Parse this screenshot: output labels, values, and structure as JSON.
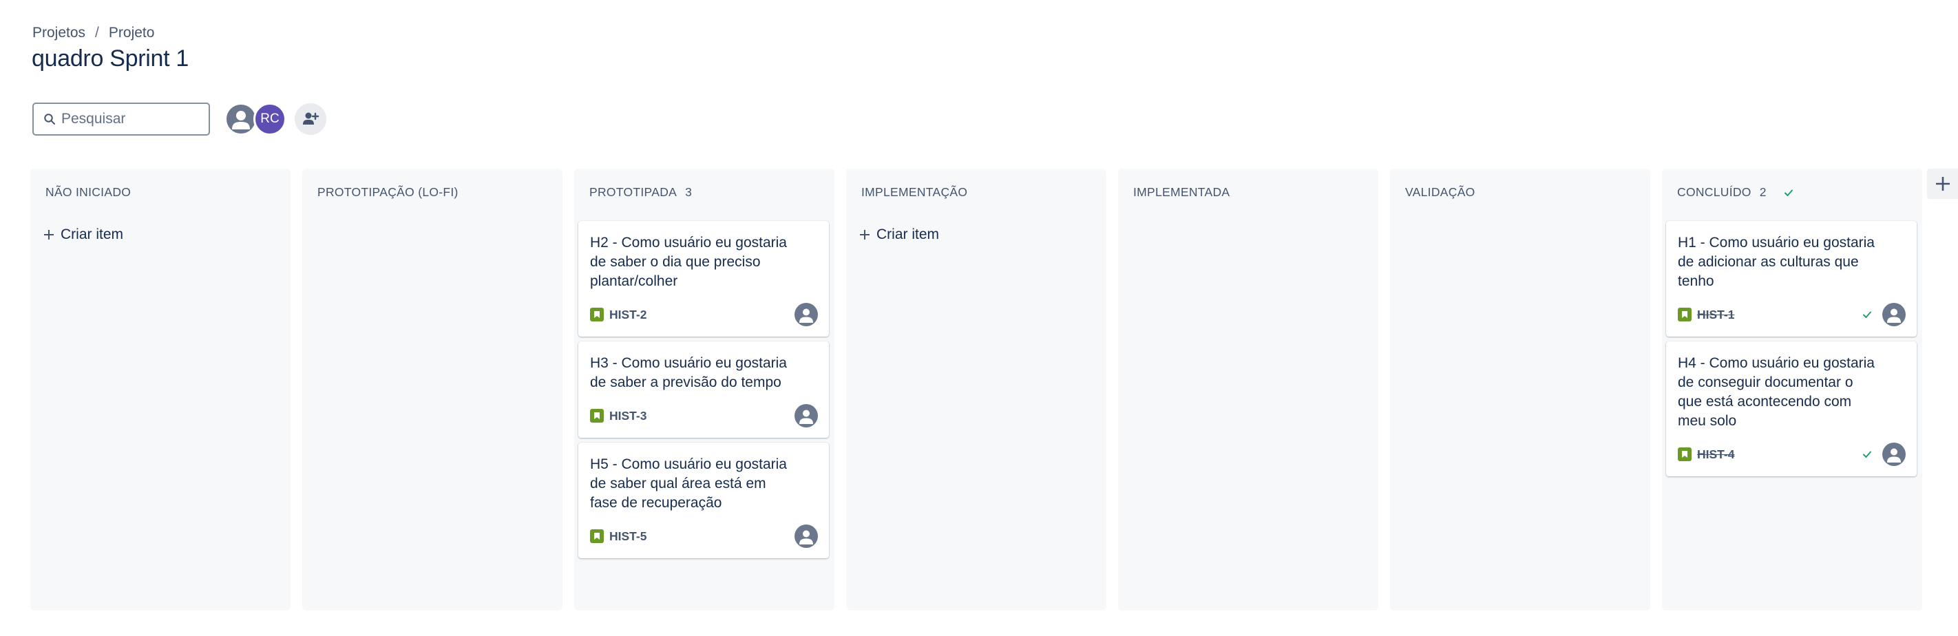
{
  "breadcrumb": {
    "items": [
      "Projetos",
      "Projeto"
    ],
    "separator": "/"
  },
  "page": {
    "title": "quadro Sprint 1"
  },
  "search": {
    "placeholder": "Pesquisar",
    "value": ""
  },
  "avatars": [
    {
      "type": "generic"
    },
    {
      "initials": "RC",
      "color": "#5e4db2"
    },
    {
      "type": "add-people"
    }
  ],
  "columns": [
    {
      "name": "NÃO INICIADO",
      "count": "",
      "create_label": "Criar item",
      "cards": []
    },
    {
      "name": "PROTOTIPAÇÃO (LO-FI)",
      "count": "",
      "cards": []
    },
    {
      "name": "PROTOTIPADA",
      "count": "3",
      "cards": [
        {
          "title": "H2 - Como usuário eu gostaria de saber o dia que preciso plantar/colher",
          "key": "HIST-2",
          "done": false
        },
        {
          "title": "H3 - Como usuário eu gostaria de saber a previsão do tempo",
          "key": "HIST-3",
          "done": false
        },
        {
          "title": "H5 - Como usuário eu gostaria de saber qual área está em fase de recuperação",
          "key": "HIST-5",
          "done": false
        }
      ]
    },
    {
      "name": "IMPLEMENTAÇÃO",
      "count": "",
      "create_label": "Criar item",
      "cards": []
    },
    {
      "name": "IMPLEMENTADA",
      "count": "",
      "cards": []
    },
    {
      "name": "VALIDAÇÃO",
      "count": "",
      "cards": []
    },
    {
      "name": "CONCLUÍDO",
      "count": "2",
      "done_column": true,
      "cards": [
        {
          "title": "H1 - Como usuário eu gostaria de adicionar as culturas que tenho",
          "key": "HIST-1",
          "done": true
        },
        {
          "title": "H4 - Como usuário eu gostaria de conseguir documentar o que está acontecendo com meu solo",
          "key": "HIST-4",
          "done": true
        }
      ]
    }
  ],
  "colors": {
    "story": "#6a9a23",
    "done_check": "#22a06b",
    "avatar_rc": "#5e4db2"
  },
  "icons": {
    "search": "search-icon",
    "add_column": "plus-icon",
    "story": "story-icon",
    "done": "check-icon"
  }
}
